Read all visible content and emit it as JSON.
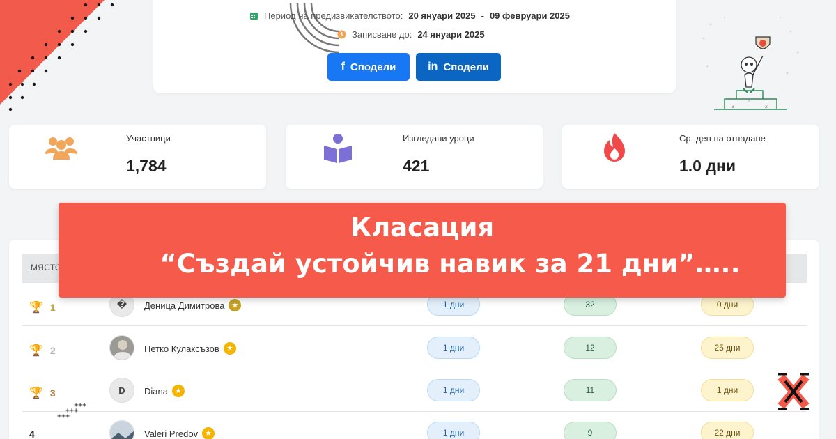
{
  "period": {
    "label": "Период на предизвикателството:",
    "start": "20 януари 2025",
    "separator": "-",
    "end": "09 февруари 2025"
  },
  "enrollment": {
    "label": "Записване до:",
    "deadline": "24 януари 2025"
  },
  "share": {
    "facebook_label": "Сподели",
    "linkedin_label": "Сподели"
  },
  "stats": [
    {
      "label": "Участници",
      "value": "1,784",
      "icon": "people-icon"
    },
    {
      "label": "Изгледани уроци",
      "value": "421",
      "icon": "book-reader-icon"
    },
    {
      "label": "Ср. ден на отпадане",
      "value": "1.0 дни",
      "icon": "fire-icon"
    }
  ],
  "table": {
    "header_place": "МЯСТО",
    "rows": [
      {
        "place": "1",
        "name": "Деница Димитрова",
        "avatar": "�",
        "days": "1 дни",
        "score": "32",
        "extra": "0 дни"
      },
      {
        "place": "2",
        "name": "Петко Кулаксъзов",
        "avatar": "",
        "days": "1 дни",
        "score": "12",
        "extra": "25 дни"
      },
      {
        "place": "3",
        "name": "Diana",
        "avatar": "D",
        "days": "1 дни",
        "score": "11",
        "extra": "1 дни"
      },
      {
        "place": "4",
        "name": "Valeri Predov",
        "avatar": "",
        "days": "1 дни",
        "score": "9",
        "extra": "22 дни"
      }
    ]
  },
  "banner": {
    "line1": "Класация",
    "line2": "“Създай устойчив навик за 21 дни”….."
  },
  "colors": {
    "accent": "#f65a4a",
    "facebook": "#1877f2",
    "linkedin": "#0a66c2",
    "gold": "#c9a227",
    "silver": "#b0b0b0",
    "bronze": "#b97a3d"
  }
}
